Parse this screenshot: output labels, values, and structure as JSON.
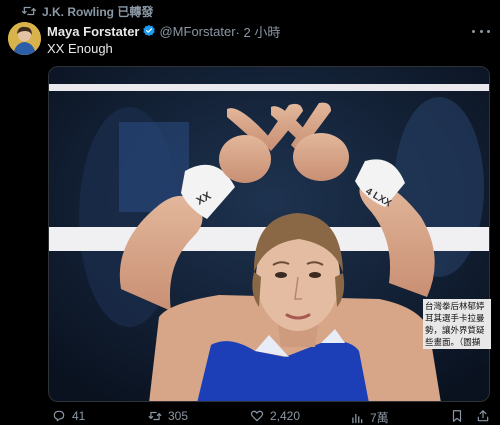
{
  "retweet": {
    "label": "J.K. Rowling 已轉發"
  },
  "author": {
    "name": "Maya Forstater",
    "handle": "@MForstater",
    "time": "· 2 小時"
  },
  "tweet": {
    "text": "XX Enough"
  },
  "media": {
    "tape_text": "XX",
    "tape_text_right": "4 LXX",
    "caption": "台灣拳后林郁婷\n耳其選手卡拉曼\n勢，讓外界質疑\n些畫面。（圖擷"
  },
  "actions": {
    "reply_count": "41",
    "retweet_count": "305",
    "like_count": "2,420",
    "views_count": "7萬"
  },
  "icons": {
    "retweet": "retweet-icon",
    "verified": "verified-badge-icon",
    "more": "more-options-icon",
    "reply": "reply-icon",
    "like": "like-icon",
    "views": "views-icon",
    "bookmark": "bookmark-icon",
    "share": "share-icon"
  },
  "colors": {
    "verified": "#1d9bf0",
    "muted": "#8b98a5",
    "jersey": "#1c3fb8"
  }
}
